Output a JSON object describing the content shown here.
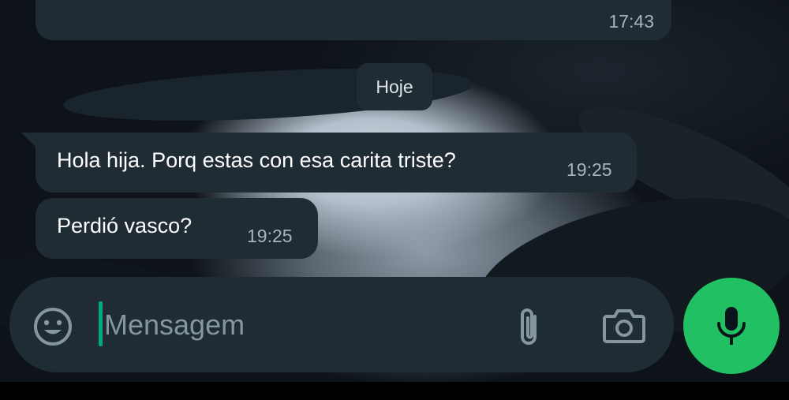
{
  "messages": [
    {
      "text": "",
      "time": "17:43"
    },
    {
      "text": "Hola hija. Porq estas con esa carita triste?",
      "time": "19:25"
    },
    {
      "text": "Perdió vasco?",
      "time": "19:25"
    }
  ],
  "date_chip": "Hoje",
  "composer": {
    "placeholder": "Mensagem",
    "emoji_icon": "emoji-icon",
    "attach_icon": "paperclip-icon",
    "camera_icon": "camera-icon",
    "mic_icon": "microphone-icon"
  },
  "colors": {
    "bubble": "#1f2c34",
    "accent": "#21c063",
    "caret": "#00a884",
    "muted_text": "#a9b3ba"
  }
}
